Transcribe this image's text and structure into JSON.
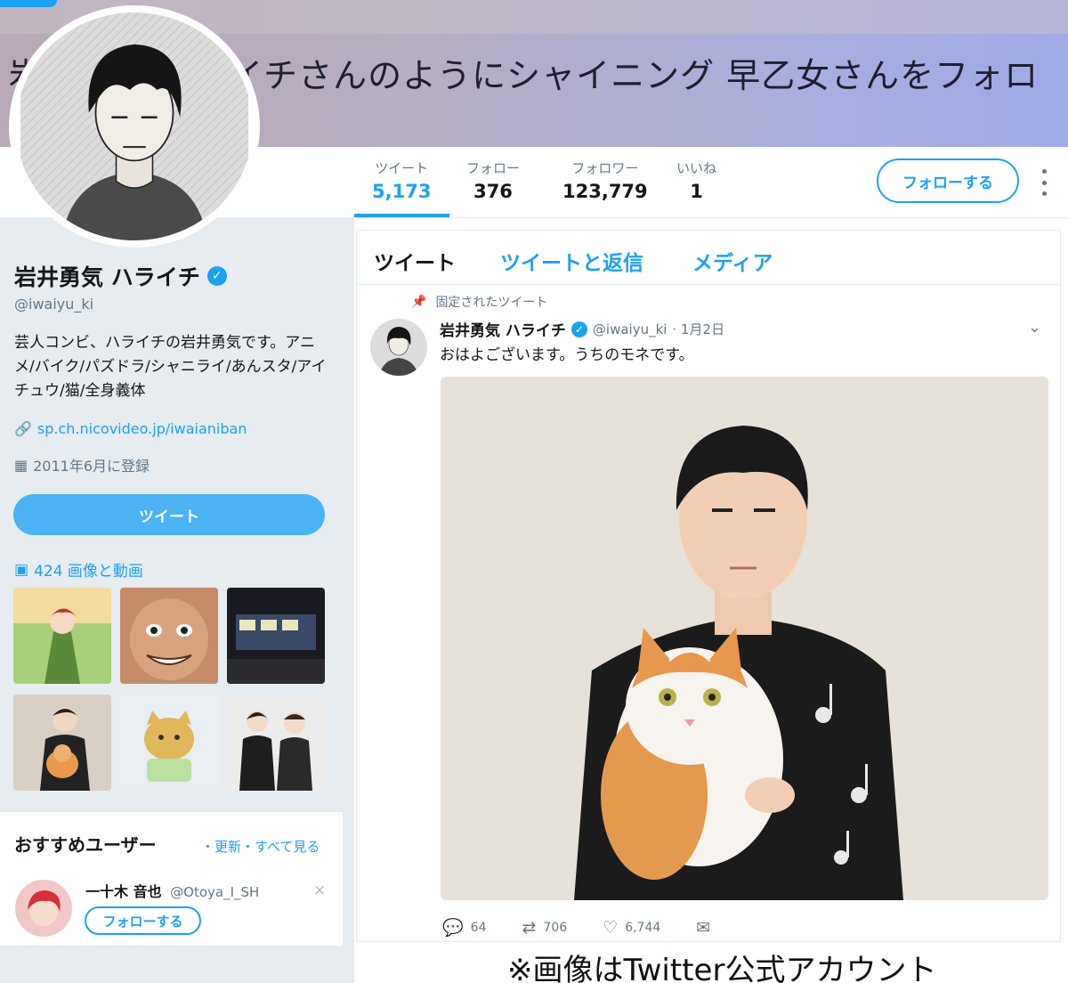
{
  "banner": {
    "text": "岩井勇気 ハライチさんのようにシャイニング 早乙女さんをフォローしよう？"
  },
  "stats": [
    {
      "label": "ツイート",
      "value": "5,173"
    },
    {
      "label": "フォロー",
      "value": "376"
    },
    {
      "label": "フォロワー",
      "value": "123,779"
    },
    {
      "label": "いいね",
      "value": "1"
    }
  ],
  "follow_button": "フォローする",
  "profile": {
    "name": "岩井勇気 ハライチ",
    "handle": "@iwaiyu_ki",
    "bio": "芸人コンビ、ハライチの岩井勇気です。アニメ/バイク/パズドラ/シャニライ/あんスタ/アイチュウ/猫/全身義体",
    "link": "sp.ch.nicovideo.jp/iwaianiban",
    "joined": "2011年6月に登録",
    "tweet_button": "ツイート",
    "media_label": "424 画像と動画"
  },
  "recommended": {
    "title": "おすすめユーザー",
    "links": "・更新・すべて見る",
    "user_name": "一十木 音也",
    "user_handle": "@Otoya_I_SH",
    "follow": "フォローする",
    "close": "×"
  },
  "tabs": [
    "ツイート",
    "ツイートと返信",
    "メディア"
  ],
  "tweet": {
    "pinned_label": "固定されたツイート",
    "name": "岩井勇気 ハライチ",
    "handle": "@iwaiyu_ki",
    "date": "· 1月2日",
    "text": "おはよございます。うちのモネです。",
    "replies": "64",
    "retweets": "706",
    "likes": "6,744"
  },
  "icons": {
    "verified": "verified-icon",
    "link": "link-icon",
    "calendar": "calendar-icon",
    "media": "image-icon",
    "pin": "pin-icon",
    "reply": "reply-icon",
    "retweet": "retweet-icon",
    "like": "heart-icon",
    "dm": "mail-icon"
  },
  "colors": {
    "accent": "#1da1f2",
    "secondary_text": "#657786",
    "background": "#e6ecf0"
  },
  "credit": "※画像はTwitter公式アカウント"
}
